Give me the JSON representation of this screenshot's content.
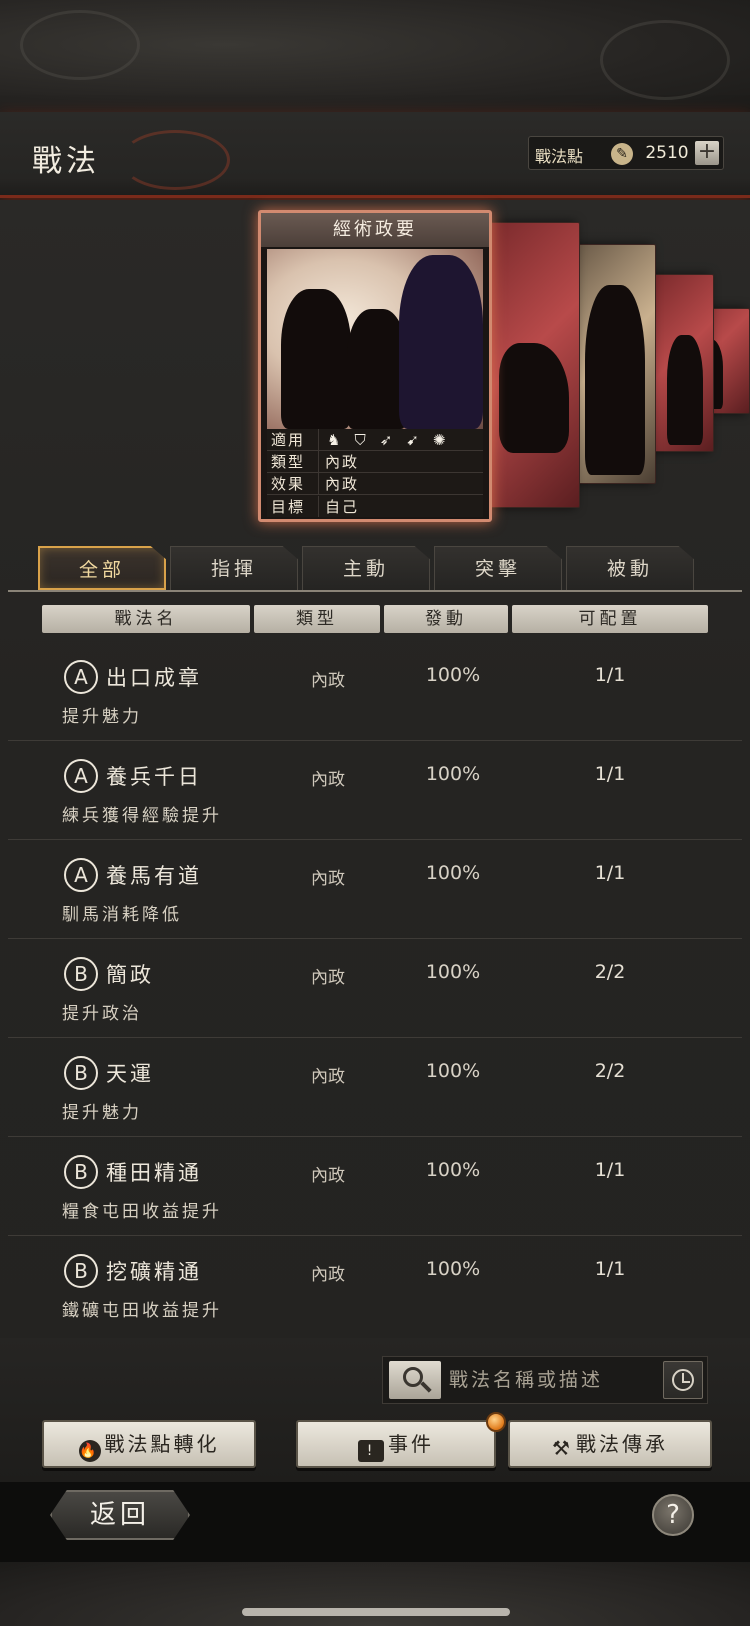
{
  "header": {
    "title": "戰法",
    "points_label": "戰法點",
    "points_value": "2510",
    "plus_symbol": "+"
  },
  "featured_card": {
    "title": "經術政要",
    "stats": [
      {
        "key": "適用",
        "value": ""
      },
      {
        "key": "類型",
        "value": "內政"
      },
      {
        "key": "效果",
        "value": "內政"
      },
      {
        "key": "目標",
        "value": "自己"
      }
    ],
    "applicable_icons": [
      "cavalry-icon",
      "shield-icon",
      "bow-icon",
      "spear-icon",
      "wheel-icon"
    ]
  },
  "tabs": [
    {
      "label": "全部",
      "active": true
    },
    {
      "label": "指揮",
      "active": false
    },
    {
      "label": "主動",
      "active": false
    },
    {
      "label": "突擊",
      "active": false
    },
    {
      "label": "被動",
      "active": false
    }
  ],
  "columns": [
    "戰法名",
    "類型",
    "發動",
    "可配置"
  ],
  "tactics": [
    {
      "grade": "A",
      "name": "出口成章",
      "type": "內政",
      "rate": "100%",
      "slots": "1/1",
      "desc": "提升魅力"
    },
    {
      "grade": "A",
      "name": "養兵千日",
      "type": "內政",
      "rate": "100%",
      "slots": "1/1",
      "desc": "練兵獲得經驗提升"
    },
    {
      "grade": "A",
      "name": "養馬有道",
      "type": "內政",
      "rate": "100%",
      "slots": "1/1",
      "desc": "馴馬消耗降低"
    },
    {
      "grade": "B",
      "name": "簡政",
      "type": "內政",
      "rate": "100%",
      "slots": "2/2",
      "desc": "提升政治"
    },
    {
      "grade": "B",
      "name": "天運",
      "type": "內政",
      "rate": "100%",
      "slots": "2/2",
      "desc": "提升魅力"
    },
    {
      "grade": "B",
      "name": "種田精通",
      "type": "內政",
      "rate": "100%",
      "slots": "1/1",
      "desc": "糧食屯田收益提升"
    },
    {
      "grade": "B",
      "name": "挖礦精通",
      "type": "內政",
      "rate": "100%",
      "slots": "1/1",
      "desc": "鐵礦屯田收益提升"
    }
  ],
  "search": {
    "placeholder": "戰法名稱或描述"
  },
  "actions": {
    "convert": "戰法點轉化",
    "events": "事件",
    "inherit": "戰法傳承"
  },
  "footer": {
    "back": "返回",
    "help": "?"
  },
  "colors": {
    "accent_gold": "#d9a24a",
    "accent_red": "#7a2a1a",
    "card_glow": "#d28a70"
  }
}
